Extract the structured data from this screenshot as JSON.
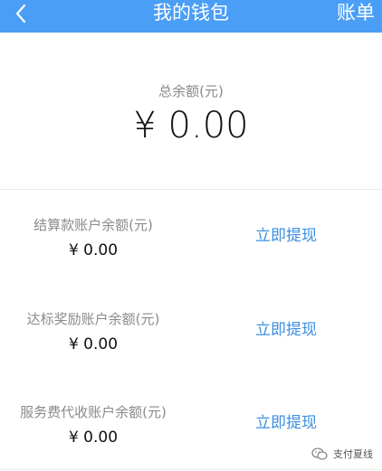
{
  "nav": {
    "back_icon": "chevron-left-icon",
    "title": "我的钱包",
    "right_label": "账单"
  },
  "summary": {
    "label": "总余额(元)",
    "value": "¥ 0.00"
  },
  "accounts": [
    {
      "label": "结算款账户余额(元)",
      "value": "¥ 0.00",
      "action": "立即提现"
    },
    {
      "label": "达标奖励账户余额(元)",
      "value": "¥ 0.00",
      "action": "立即提现"
    },
    {
      "label": "服务费代收账户余额(元)",
      "value": "¥ 0.00",
      "action": "立即提现"
    }
  ],
  "watermark": {
    "text": "支付夏线",
    "icon": "wechat-icon"
  },
  "colors": {
    "nav_bg": "#4a9ef6",
    "action": "#3b8fe0",
    "label": "#8a8a8a"
  }
}
